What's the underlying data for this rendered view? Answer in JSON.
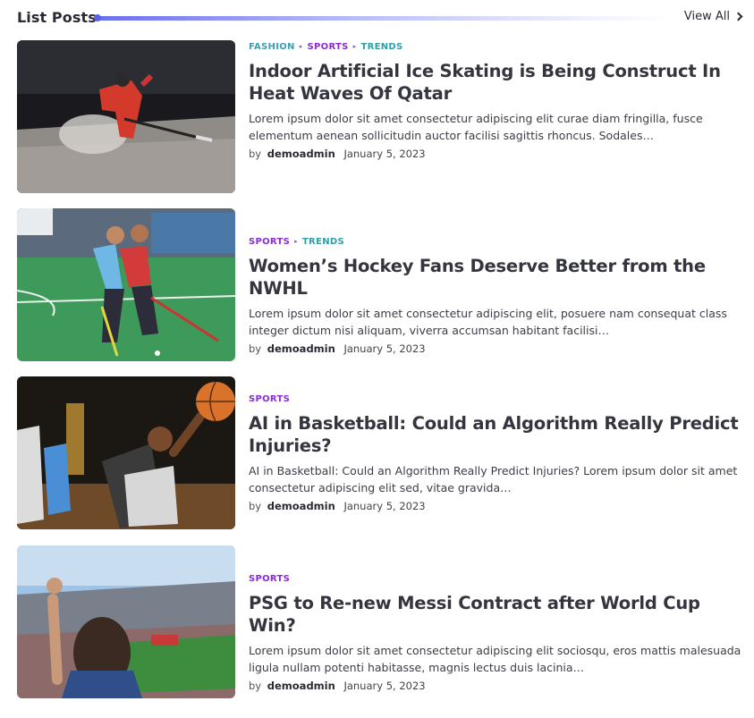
{
  "header": {
    "title": "List Posts",
    "view_all": "View All",
    "accent": "#5b60ea"
  },
  "colors": {
    "fashion": "#3a9fb8",
    "sports": "#8c2bd6",
    "trends": "#2f9fa8"
  },
  "posts": [
    {
      "categories": [
        "FASHION",
        "SPORTS",
        "TRENDS"
      ],
      "title": "Indoor Artificial Ice Skating is Being Construct In Heat Waves Of Qatar",
      "excerpt": "Lorem ipsum dolor sit amet consectetur adipiscing elit curae diam fringilla, fusce elementum aenean sollicitudin auctor facilisi sagittis rhoncus. Sodales…",
      "by": "by",
      "author": "demoadmin",
      "date": "January 5, 2023",
      "image": "ice-hockey-player"
    },
    {
      "categories": [
        "SPORTS",
        "TRENDS"
      ],
      "title": "Women’s Hockey Fans Deserve Better from the NWHL",
      "excerpt": "Lorem ipsum dolor sit amet consectetur adipiscing elit, posuere nam consequat class integer dictum nisi aliquam, viverra accumsan habitant facilisi…",
      "by": "by",
      "author": "demoadmin",
      "date": "January 5, 2023",
      "image": "field-hockey-players"
    },
    {
      "categories": [
        "SPORTS"
      ],
      "title": "AI in Basketball: Could an Algorithm Really Predict Injuries?",
      "excerpt": "AI in Basketball: Could an Algorithm Really Predict Injuries? Lorem ipsum dolor sit amet consectetur adipiscing elit sed, vitae gravida…",
      "by": "by",
      "author": "demoadmin",
      "date": "January 5, 2023",
      "image": "basketball-dunk"
    },
    {
      "categories": [
        "SPORTS"
      ],
      "title": "PSG to Re-new Messi Contract after World Cup Win?",
      "excerpt": "Lorem ipsum dolor sit amet consectetur adipiscing elit sociosqu, eros mattis malesuada ligula nullam potenti habitasse, magnis lectus duis lacinia…",
      "by": "by",
      "author": "demoadmin",
      "date": "January 5, 2023",
      "image": "football-stadium-fan"
    }
  ]
}
